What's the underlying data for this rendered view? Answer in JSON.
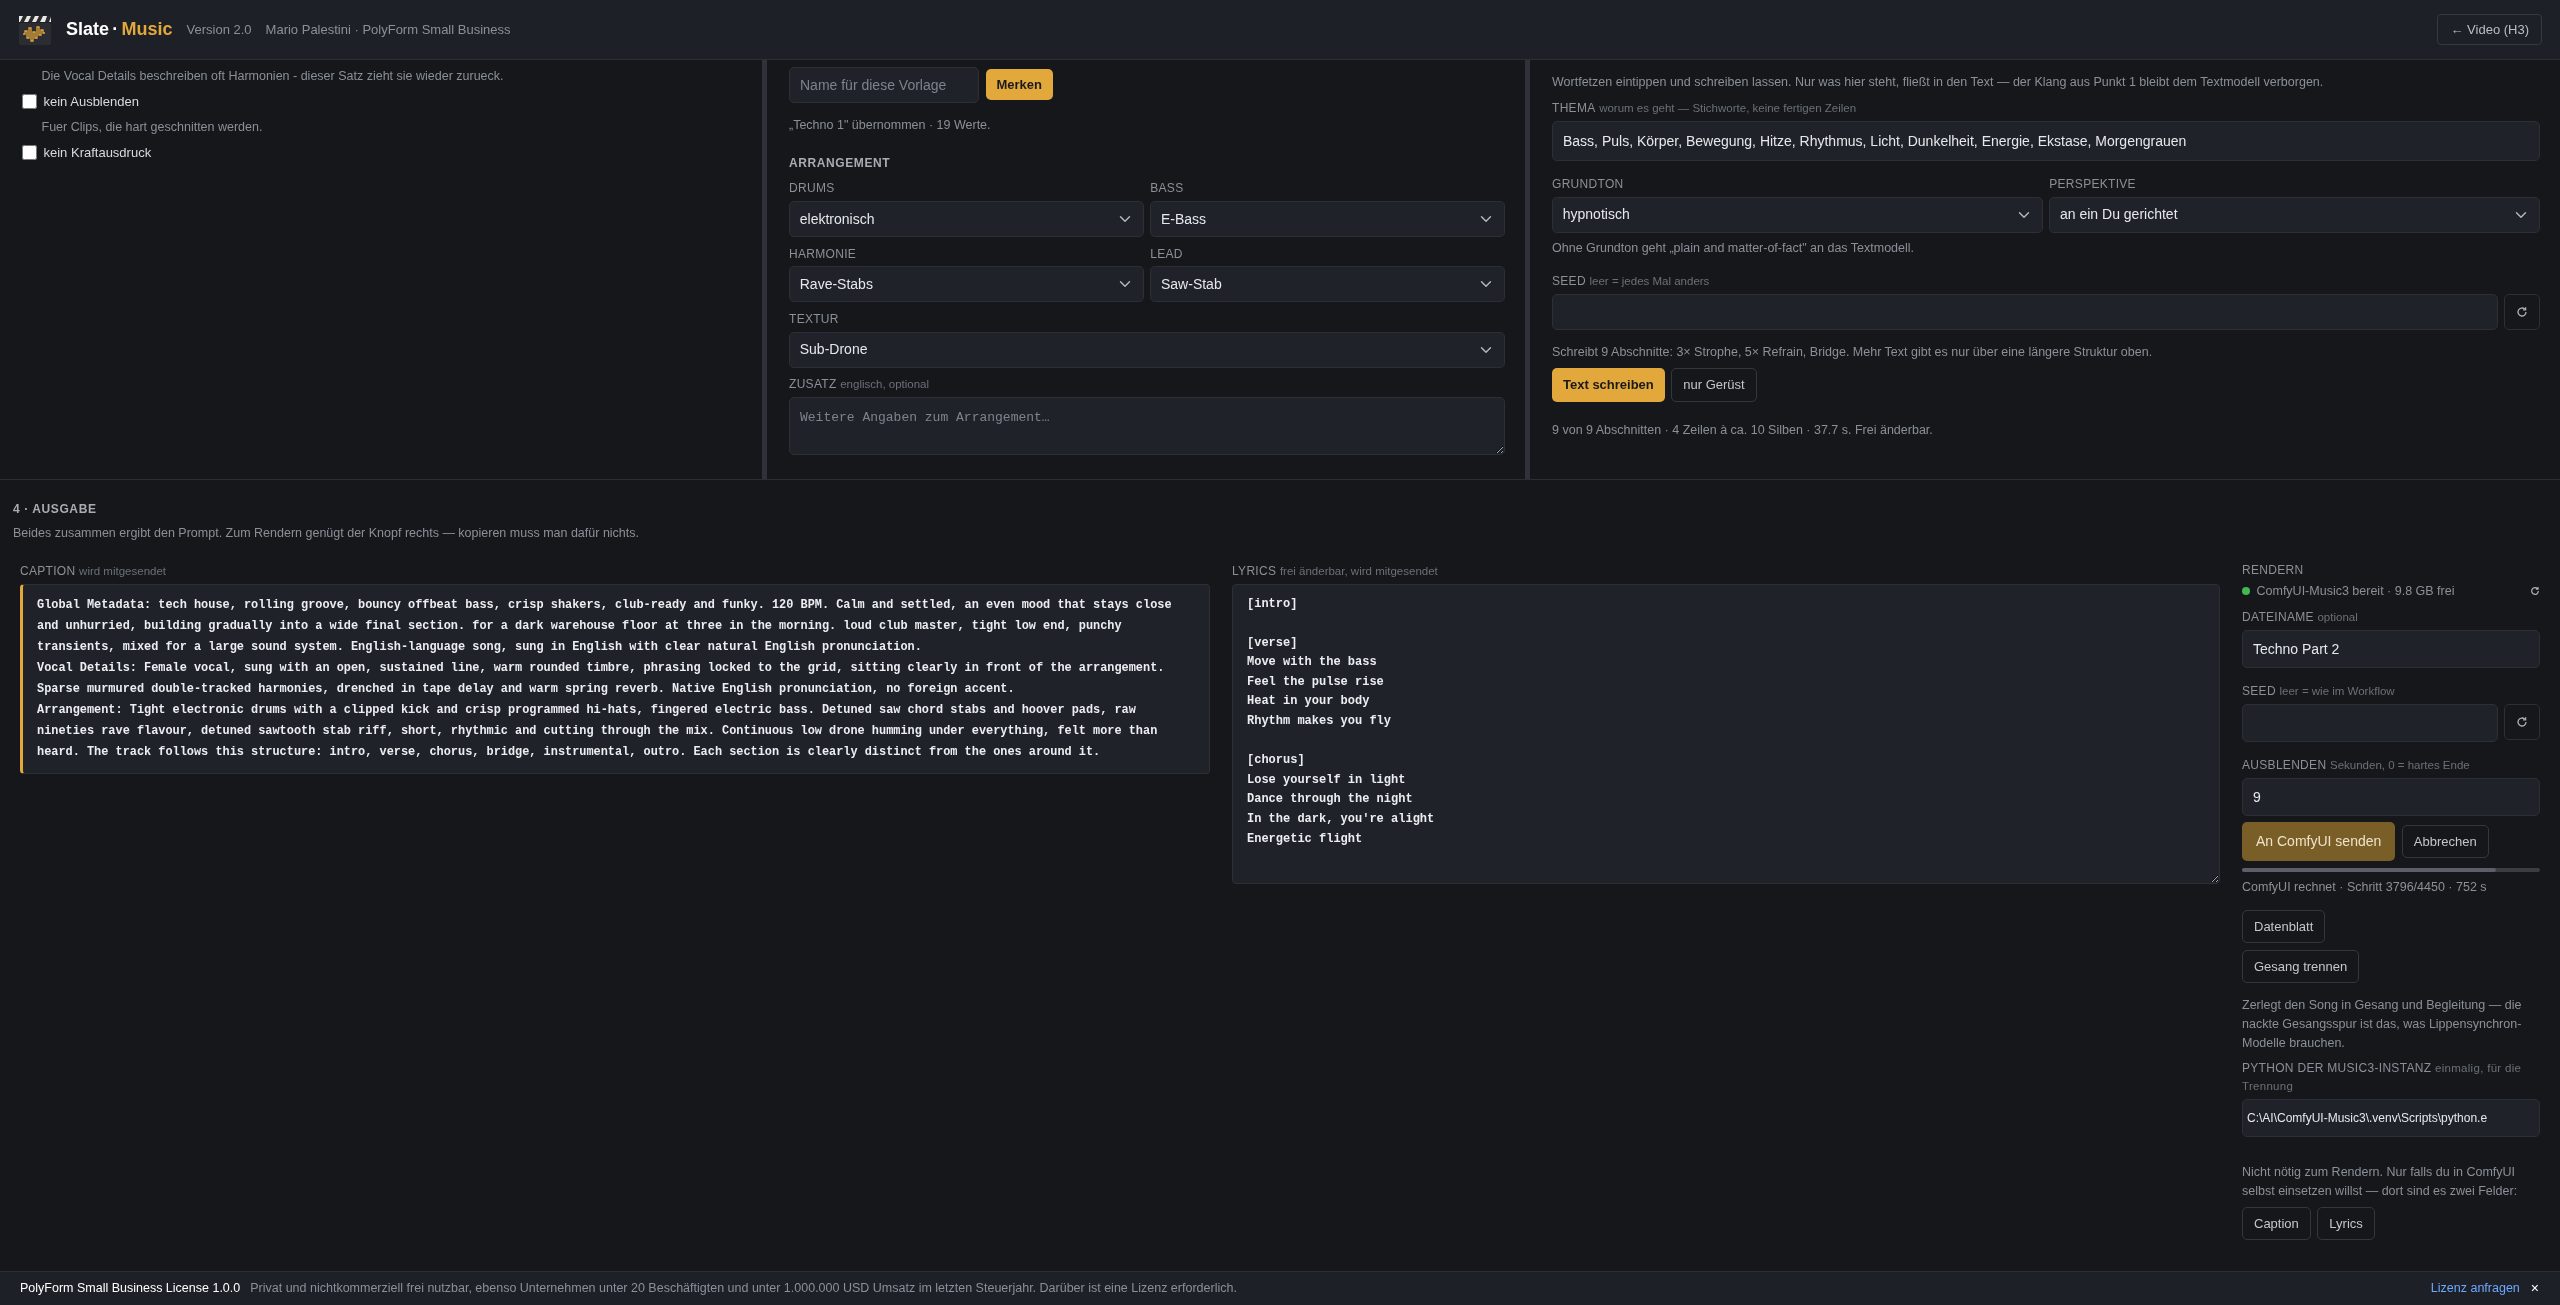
{
  "header": {
    "brand_first": "Slate",
    "brand_sep": "·",
    "brand_second": "Music",
    "version": "Version 2.0",
    "credit": "Mario Palestini · PolyForm Small Business",
    "back_button": "← Video (H3)"
  },
  "left_panel": {
    "items": [
      {
        "kind": "hint",
        "text": "Die Vocal Details beschreiben oft Harmonien - dieser Satz zieht sie wieder zurueck."
      },
      {
        "kind": "checkbox",
        "label": "kein Ausblenden",
        "checked": false
      },
      {
        "kind": "hint",
        "text": "Fuer Clips, die hart geschnitten werden."
      },
      {
        "kind": "checkbox",
        "label": "kein Kraftausdruck",
        "checked": false
      }
    ]
  },
  "middle_panel": {
    "preset": {
      "placeholder": "Name für diese Vorlage",
      "button": "Merken",
      "status": "„Techno 1\" übernommen · 19 Werte."
    },
    "heading": "ARRANGEMENT",
    "select_rows": [
      [
        {
          "label": "DRUMS",
          "value": "elektronisch"
        },
        {
          "label": "BASS",
          "value": "E-Bass"
        }
      ],
      [
        {
          "label": "HARMONIE",
          "value": "Rave-Stabs"
        },
        {
          "label": "LEAD",
          "value": "Saw-Stab"
        }
      ],
      [
        {
          "label": "TEXTUR",
          "value": "Sub-Drone"
        }
      ]
    ],
    "extra": {
      "label": "ZUSATZ",
      "hint": "englisch, optional",
      "placeholder": "Weitere Angaben zum Arrangement…"
    }
  },
  "right_panel": {
    "intro": "Wortfetzen eintippen und schreiben lassen. Nur was hier steht, fließt in den Text — der Klang aus Punkt 1 bleibt dem Textmodell verborgen.",
    "theme": {
      "label": "THEMA",
      "hint": "worum es geht — Stichworte, keine fertigen Zeilen",
      "value": "Bass, Puls, Körper, Bewegung, Hitze, Rhythmus, Licht, Dunkelheit, Energie, Ekstase, Morgengrauen"
    },
    "selects": [
      {
        "label": "GRUNDTON",
        "value": "hypnotisch"
      },
      {
        "label": "PERSPEKTIVE",
        "value": "an ein Du gerichtet"
      }
    ],
    "tone_note": "Ohne Grundton geht „plain and matter-of-fact\" an das Textmodell.",
    "seed": {
      "label": "SEED",
      "hint": "leer = jedes Mal anders"
    },
    "plan": "Schreibt 9 Abschnitte: 3× Strophe, 5× Refrain, Bridge. Mehr Text gibt es nur über eine längere Struktur oben.",
    "write_button": "Text schreiben",
    "skeleton_button": "nur Gerüst",
    "summary": "9 von 9 Abschnitten · 4 Zeilen à ca. 10 Silben · 37.7 s. Frei änderbar."
  },
  "output": {
    "heading": "4 · AUSGABE",
    "description": "Beides zusammen ergibt den Prompt. Zum Rendern genügt der Knopf rechts — kopieren muss man dafür nichts.",
    "caption": {
      "label": "CAPTION",
      "hint": "wird mitgesendet",
      "lines": [
        "Global Metadata: tech house, rolling groove, bouncy offbeat bass, crisp shakers, club-ready and funky. 120 BPM. Calm and settled, an even mood that stays close and unhurried, building gradually into a wide final section. for a dark warehouse floor at three in the morning. loud club master, tight low end, punchy transients, mixed for a large sound system. English-language song, sung in English with clear natural English pronunciation.",
        "Vocal Details: Female vocal, sung with an open, sustained line, warm rounded timbre, phrasing locked to the grid, sitting clearly in front of the arrangement. Sparse murmured double-tracked harmonies, drenched in tape delay and warm spring reverb. Native English pronunciation, no foreign accent.",
        "Arrangement: Tight electronic drums with a clipped kick and crisp programmed hi-hats, fingered electric bass. Detuned saw chord stabs and hoover pads, raw nineties rave flavour, detuned sawtooth stab riff, short, rhythmic and cutting through the mix. Continuous low drone humming under everything, felt more than heard. The track follows this structure: intro, verse, chorus, bridge, instrumental, outro. Each section is clearly distinct from the ones around it."
      ]
    },
    "lyrics": {
      "label": "LYRICS",
      "hint": "frei änderbar, wird mitgesendet",
      "text": "[intro]\n\n[verse]\nMove with the bass\nFeel the pulse rise\nHeat in your body\nRhythm makes you fly\n\n[chorus]\nLose yourself in light\nDance through the night\nIn the dark, you're alight\nEnergetic flight"
    },
    "render": {
      "heading": "RENDERN",
      "status": {
        "text": "ComfyUI-Music3 bereit · 9.8 GB frei",
        "color": "#3fb950"
      },
      "filename": {
        "label": "DATEINAME",
        "hint": "optional",
        "value": "Techno Part 2"
      },
      "seed": {
        "label": "SEED",
        "hint": "leer = wie im Workflow"
      },
      "fade": {
        "label": "AUSBLENDEN",
        "hint": "Sekunden, 0 = hartes Ende",
        "value": "9"
      },
      "send_button": {
        "label": "An ComfyUI senden",
        "disabled": true
      },
      "cancel_button": "Abbrechen",
      "progress": {
        "level": 0.853
      },
      "progress_text": "ComfyUI rechnet · Schritt 3796/4450 · 752 s",
      "sheet_button": "Datenblatt",
      "separate_button": "Gesang trennen",
      "separate_text": "Zerlegt den Song in Gesang und Begleitung — die nackte Gesangsspur ist das, was Lippensynchron-Modelle brauchen.",
      "python": {
        "label": "PYTHON DER MUSIC3-INSTANZ",
        "hint": "einmalig, für die Trennung",
        "value": "C:\\AI\\ComfyUI-Music3\\.venv\\Scripts\\python.e"
      },
      "copy_note": "Nicht nötig zum Rendern. Nur falls du in ComfyUI selbst einsetzen willst — dort sind es zwei Felder:",
      "copy_buttons": [
        "Caption",
        "Lyrics"
      ]
    }
  },
  "footer": {
    "license": "PolyForm Small Business License 1.0.0",
    "text": "Privat und nichtkommerziell frei nutzbar, ebenso Unternehmen unter 20 Beschäftigten und unter 1.000.000 USD Umsatz im letzten Steuerjahr. Darüber ist eine Lizenz erforderlich.",
    "link": "Lizenz anfragen",
    "close": "×"
  }
}
